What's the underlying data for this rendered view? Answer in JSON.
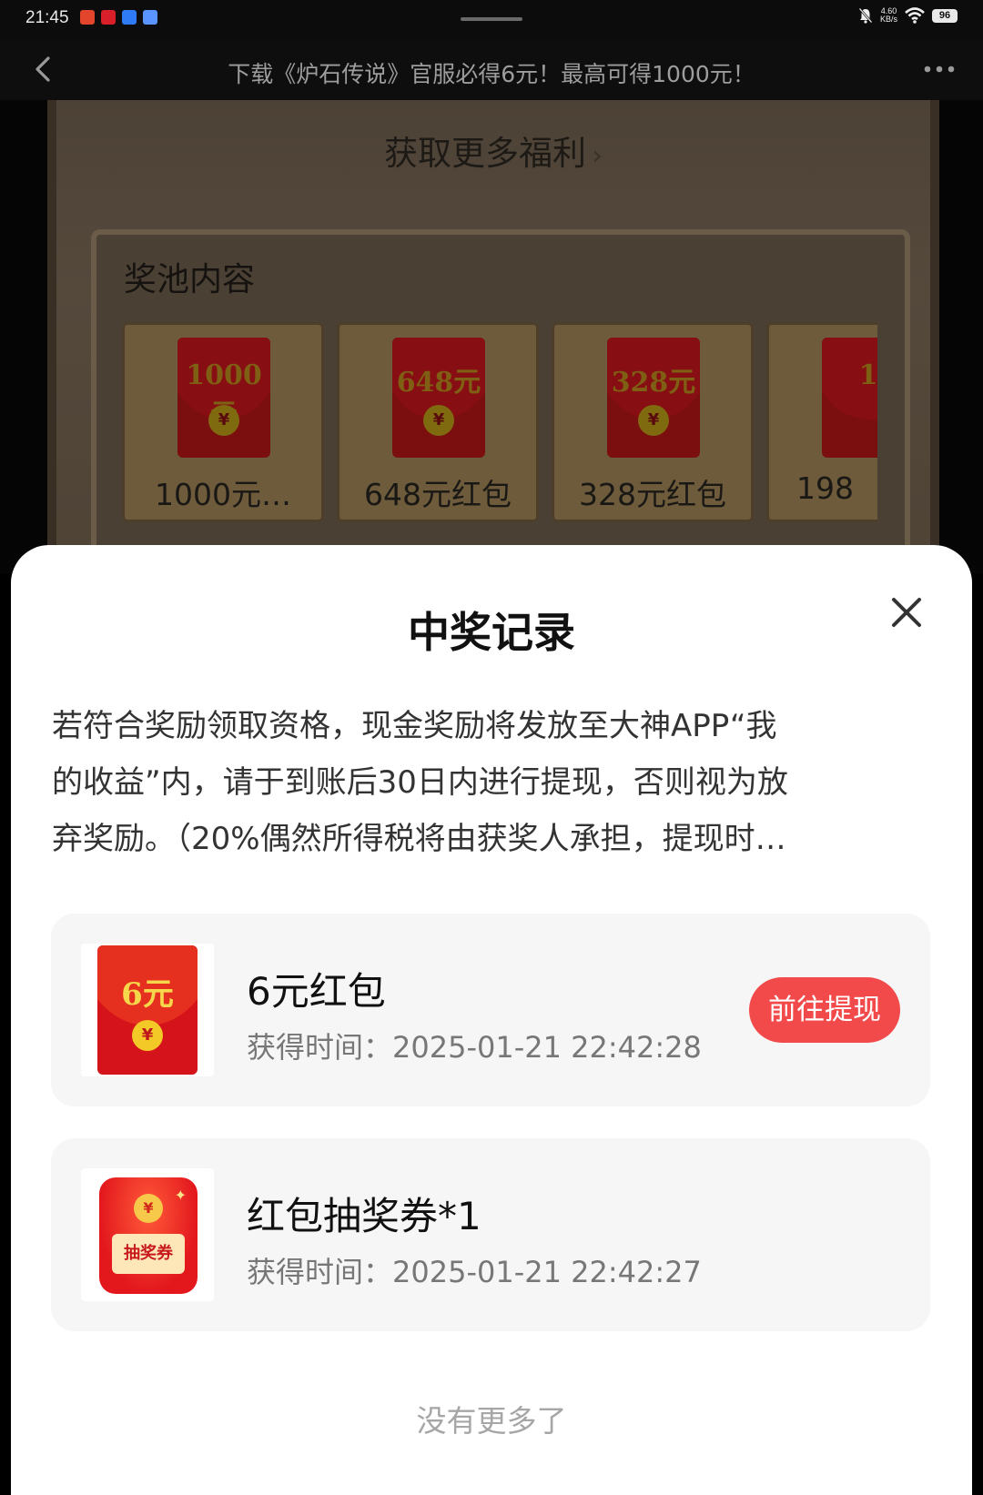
{
  "status_bar": {
    "time": "21:45",
    "net_speed_value": "4.60",
    "net_speed_unit": "KB/s",
    "battery": "96",
    "notification_icons": [
      "app-notification-icon",
      "netease-icon",
      "app-notification-icon",
      "app-notification-icon"
    ]
  },
  "nav": {
    "title": "下载《炉石传说》官服必得6元！最高可得1000元！",
    "back_icon": "chevron-left-icon",
    "more_icon": "more-dots-icon"
  },
  "background_page": {
    "more_benefits": "获取更多福利",
    "more_benefits_chevron": "›",
    "pool_title": "奖池内容",
    "prizes": [
      {
        "amount": "1000元",
        "label": "1000元…"
      },
      {
        "amount": "648元",
        "label": "648元红包"
      },
      {
        "amount": "328元",
        "label": "328元红包"
      },
      {
        "amount": "1",
        "label": "198"
      }
    ],
    "coin_symbol": "¥"
  },
  "sheet": {
    "title": "中奖记录",
    "notice_lines": [
      "若符合奖励领取资格，现金奖励将发放至大神APP“我",
      "的收益”内，请于到账后30日内进行提现，否则视为放",
      "弃奖励。（20%偶然所得税将由获奖人承担，提现时…"
    ],
    "records": [
      {
        "name": "6元红包",
        "time_label": "获得时间：",
        "time": "2025-01-21 22:42:28",
        "thumb_amount": "6元",
        "coin_symbol": "¥",
        "action": "前往提现"
      },
      {
        "name": "红包抽奖券*1",
        "time_label": "获得时间：",
        "time": "2025-01-21 22:42:27",
        "thumb_coin": "¥",
        "thumb_text": "抽奖券"
      }
    ],
    "footer": "没有更多了"
  },
  "colors": {
    "accent_button": "#f24a4a",
    "sheet_background": "#ffffff",
    "record_background": "#f6f6f6"
  }
}
